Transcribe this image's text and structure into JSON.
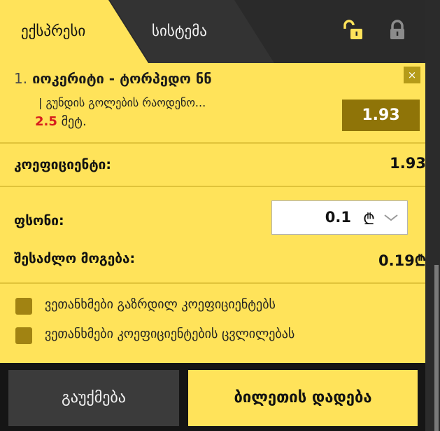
{
  "tabs": [
    {
      "label": "ექსპრესი",
      "active": true
    },
    {
      "label": "სისტემა",
      "active": false
    }
  ],
  "icons": {
    "lock_open": "lock-open-icon",
    "lock_closed": "lock-closed-icon",
    "close": "close-icon",
    "chevron": "chevron-down-icon"
  },
  "bet": {
    "number": "1.",
    "match": "იოკერიტი - ტორპედო ნნ",
    "market": "| გუნდის გოლების რაოდენო...",
    "line_value": "2.5",
    "line_suffix": "მეტ.",
    "close_label": "×",
    "odd": "1.93"
  },
  "coefficient": {
    "label": "კოეფიციენტი:",
    "value": "1.93"
  },
  "stake": {
    "label": "ფსონი:",
    "value": "0.1",
    "currency": "₾"
  },
  "possible_win": {
    "label": "შესაძლო მოგება:",
    "value": "0.19₾"
  },
  "options": [
    {
      "label": "ვეთანხმები გაზრდილ კოეფიციენტებს"
    },
    {
      "label": "ვეთანხმები კოეფიციენტების ცვლილებას"
    }
  ],
  "buttons": {
    "cancel": "გაუქმება",
    "place": "ბილეთის დადება"
  },
  "colors": {
    "accent": "#ffe35a",
    "odd_box": "#8f7408",
    "highlight_red": "#d61d1d",
    "dark": "#2a2a2a"
  }
}
